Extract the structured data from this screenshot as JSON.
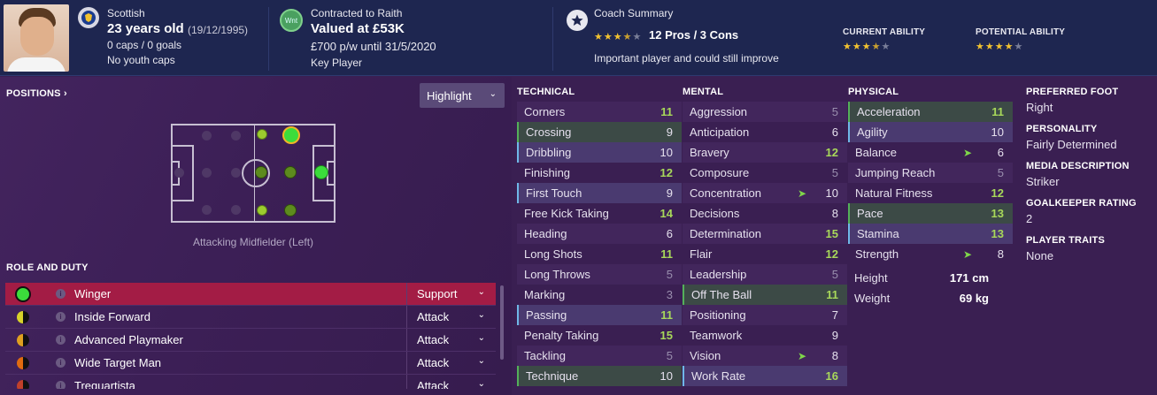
{
  "header": {
    "nationality": "Scottish",
    "age": "23 years old",
    "dob": "(19/12/1995)",
    "caps": "0 caps / 0 goals",
    "youth_caps": "No youth caps",
    "contract_badge": "Wnt",
    "contract": "Contracted to Raith",
    "value": "Valued at £53K",
    "wage": "£700 p/w until 31/5/2020",
    "squad_status": "Key Player",
    "coach_summary_title": "Coach Summary",
    "coach_pros_cons": "12 Pros / 3 Cons",
    "coach_note": "Important player and could still improve",
    "coach_stars": 3.5,
    "current_ability_label": "CURRENT ABILITY",
    "current_ability_stars": 3.5,
    "potential_ability_label": "POTENTIAL ABILITY",
    "potential_ability_stars": 4
  },
  "positions": {
    "title": "POSITIONS ›",
    "highlight_label": "Highlight",
    "selected_position": "Attacking Midfielder (Left)"
  },
  "roles": {
    "title": "ROLE AND DUTY",
    "items": [
      {
        "name": "Winger",
        "duty": "Support",
        "indicator_color": "#3bdc3b",
        "selected": true
      },
      {
        "name": "Inside Forward",
        "duty": "Attack",
        "indicator_color": "#d8d32a"
      },
      {
        "name": "Advanced Playmaker",
        "duty": "Attack",
        "indicator_color": "#e0a020"
      },
      {
        "name": "Wide Target Man",
        "duty": "Attack",
        "indicator_color": "#e06b10"
      },
      {
        "name": "Trequartista",
        "duty": "Attack",
        "indicator_color": "#c0402a"
      }
    ]
  },
  "technical": {
    "title": "TECHNICAL",
    "items": [
      {
        "label": "Corners",
        "value": "11"
      },
      {
        "label": "Crossing",
        "value": "9"
      },
      {
        "label": "Dribbling",
        "value": "10"
      },
      {
        "label": "Finishing",
        "value": "12"
      },
      {
        "label": "First Touch",
        "value": "9"
      },
      {
        "label": "Free Kick Taking",
        "value": "14"
      },
      {
        "label": "Heading",
        "value": "6"
      },
      {
        "label": "Long Shots",
        "value": "11"
      },
      {
        "label": "Long Throws",
        "value": "5"
      },
      {
        "label": "Marking",
        "value": "3"
      },
      {
        "label": "Passing",
        "value": "11"
      },
      {
        "label": "Penalty Taking",
        "value": "15"
      },
      {
        "label": "Tackling",
        "value": "5"
      },
      {
        "label": "Technique",
        "value": "10"
      }
    ]
  },
  "mental": {
    "title": "MENTAL",
    "items": [
      {
        "label": "Aggression",
        "value": "5"
      },
      {
        "label": "Anticipation",
        "value": "6"
      },
      {
        "label": "Bravery",
        "value": "12"
      },
      {
        "label": "Composure",
        "value": "5"
      },
      {
        "label": "Concentration",
        "value": "10"
      },
      {
        "label": "Decisions",
        "value": "8"
      },
      {
        "label": "Determination",
        "value": "15"
      },
      {
        "label": "Flair",
        "value": "12"
      },
      {
        "label": "Leadership",
        "value": "5"
      },
      {
        "label": "Off The Ball",
        "value": "11"
      },
      {
        "label": "Positioning",
        "value": "7"
      },
      {
        "label": "Teamwork",
        "value": "9"
      },
      {
        "label": "Vision",
        "value": "8"
      },
      {
        "label": "Work Rate",
        "value": "16"
      }
    ]
  },
  "physical": {
    "title": "PHYSICAL",
    "items": [
      {
        "label": "Acceleration",
        "value": "11"
      },
      {
        "label": "Agility",
        "value": "10"
      },
      {
        "label": "Balance",
        "value": "6"
      },
      {
        "label": "Jumping Reach",
        "value": "5"
      },
      {
        "label": "Natural Fitness",
        "value": "12"
      },
      {
        "label": "Pace",
        "value": "13"
      },
      {
        "label": "Stamina",
        "value": "13"
      },
      {
        "label": "Strength",
        "value": "8"
      }
    ],
    "height_label": "Height",
    "height": "171 cm",
    "weight_label": "Weight",
    "weight": "69 kg"
  },
  "info": {
    "preferred_foot_title": "PREFERRED FOOT",
    "preferred_foot": "Right",
    "personality_title": "PERSONALITY",
    "personality": "Fairly Determined",
    "media_title": "MEDIA DESCRIPTION",
    "media": "Striker",
    "gk_title": "GOALKEEPER RATING",
    "gk": "2",
    "traits_title": "PLAYER TRAITS",
    "traits": "None"
  }
}
